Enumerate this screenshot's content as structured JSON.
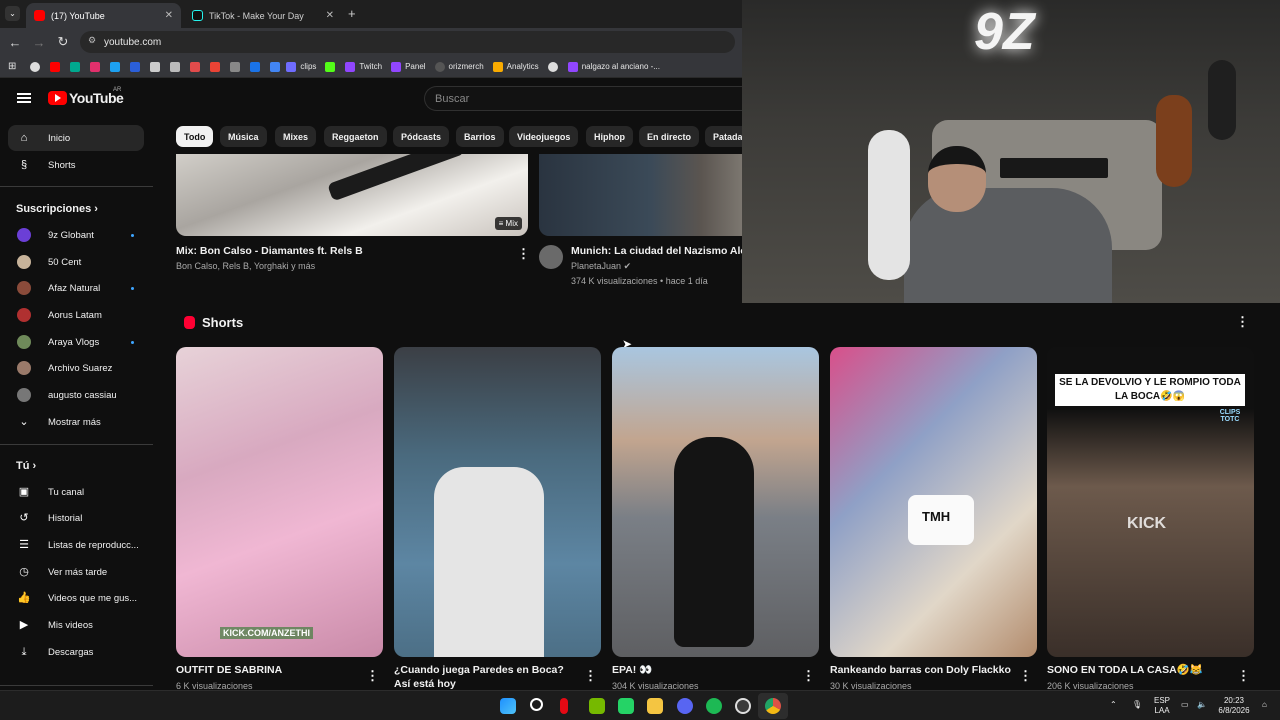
{
  "browser": {
    "tabs": [
      {
        "label": "(17) YouTube",
        "active": true
      },
      {
        "label": "TikTok - Make Your Day",
        "active": false
      }
    ],
    "new_tab": "+",
    "url": "youtube.com",
    "bookmarks": [
      {
        "label": "clips",
        "color": "#6f6cff"
      },
      {
        "label": "Twitch",
        "color": "#9146ff"
      },
      {
        "label": "Panel",
        "color": "#9146ff"
      },
      {
        "label": "orizmerch",
        "color": "#444"
      },
      {
        "label": "Analytics",
        "color": "#f9ab00"
      },
      {
        "label": "nalgazo al anciano -...",
        "color": "#9146ff"
      }
    ]
  },
  "youtube": {
    "logo_text": "YouTube",
    "country": "AR",
    "search_placeholder": "Buscar",
    "sidebar": {
      "main": [
        {
          "label": "Inicio",
          "icon": "home-icon",
          "active": true
        },
        {
          "label": "Shorts",
          "icon": "shorts-icon",
          "active": false
        }
      ],
      "subscriptions_title": "Suscripciones",
      "subscriptions": [
        {
          "label": "9z Globant",
          "color": "#6b3fd6",
          "live": true
        },
        {
          "label": "50 Cent",
          "color": "#c7b39a",
          "live": false
        },
        {
          "label": "Afaz Natural",
          "color": "#8a4b3a",
          "live": true
        },
        {
          "label": "Aorus Latam",
          "color": "#b03030",
          "live": false
        },
        {
          "label": "Araya Vlogs",
          "color": "#6f8a5a",
          "live": true
        },
        {
          "label": "Archivo Suarez",
          "color": "#9a7a6a",
          "live": false
        },
        {
          "label": "augusto cassiau",
          "color": "#777",
          "live": false
        }
      ],
      "show_more": "Mostrar más",
      "you_title": "Tú",
      "you_items": [
        {
          "label": "Tu canal",
          "icon": "channel-icon"
        },
        {
          "label": "Historial",
          "icon": "history-icon"
        },
        {
          "label": "Listas de reproducc...",
          "icon": "playlists-icon"
        },
        {
          "label": "Ver más tarde",
          "icon": "watch-later-icon"
        },
        {
          "label": "Videos que me gus...",
          "icon": "like-icon"
        },
        {
          "label": "Mis videos",
          "icon": "my-videos-icon"
        },
        {
          "label": "Descargas",
          "icon": "download-icon"
        }
      ]
    },
    "chips": [
      "Todo",
      "Música",
      "Mixes",
      "Reggaeton",
      "Pódcasts",
      "Barrios",
      "Videojuegos",
      "Hiphop",
      "En directo",
      "Patada"
    ],
    "videos": [
      {
        "title": "Mix: Bon Calso - Diamantes ft. Rels B",
        "channel": "Bon Calso, Rels B, Yorghaki y más",
        "badge": "Mix"
      },
      {
        "title": "Munich: La ciudad del Nazismo Aler",
        "channel": "PlanetaJuan",
        "stats": "374 K visualizaciones • hace 1 día"
      }
    ],
    "shorts_title": "Shorts",
    "shorts": [
      {
        "title": "OUTFIT DE SABRINA",
        "views": "6 K visualizaciones",
        "overlay": "KICK.COM/ANZETHI"
      },
      {
        "title": "¿Cuando juega Paredes en Boca? Así está hoy",
        "views": ""
      },
      {
        "title": "EPA! 👀",
        "views": "304 K visualizaciones"
      },
      {
        "title": "Rankeando barras con Doly Flackko",
        "views": "30 K visualizaciones",
        "overlay": "TMH"
      },
      {
        "title": "SONO EN TODA LA CASA🤣😹",
        "views": "206 K visualizaciones",
        "overlay": "SE LA DEVOLVIO Y LE ROMPIO TODA LA BOCA🤣😱",
        "watermark": "KICK",
        "logo": "CLIPS TOTC"
      }
    ]
  },
  "webcam": {
    "wall_logo": "9Z"
  },
  "taskbar": {
    "lang_top": "ESP",
    "lang_bottom": "LAA",
    "time": "20:23",
    "date": "6/8/2026"
  }
}
